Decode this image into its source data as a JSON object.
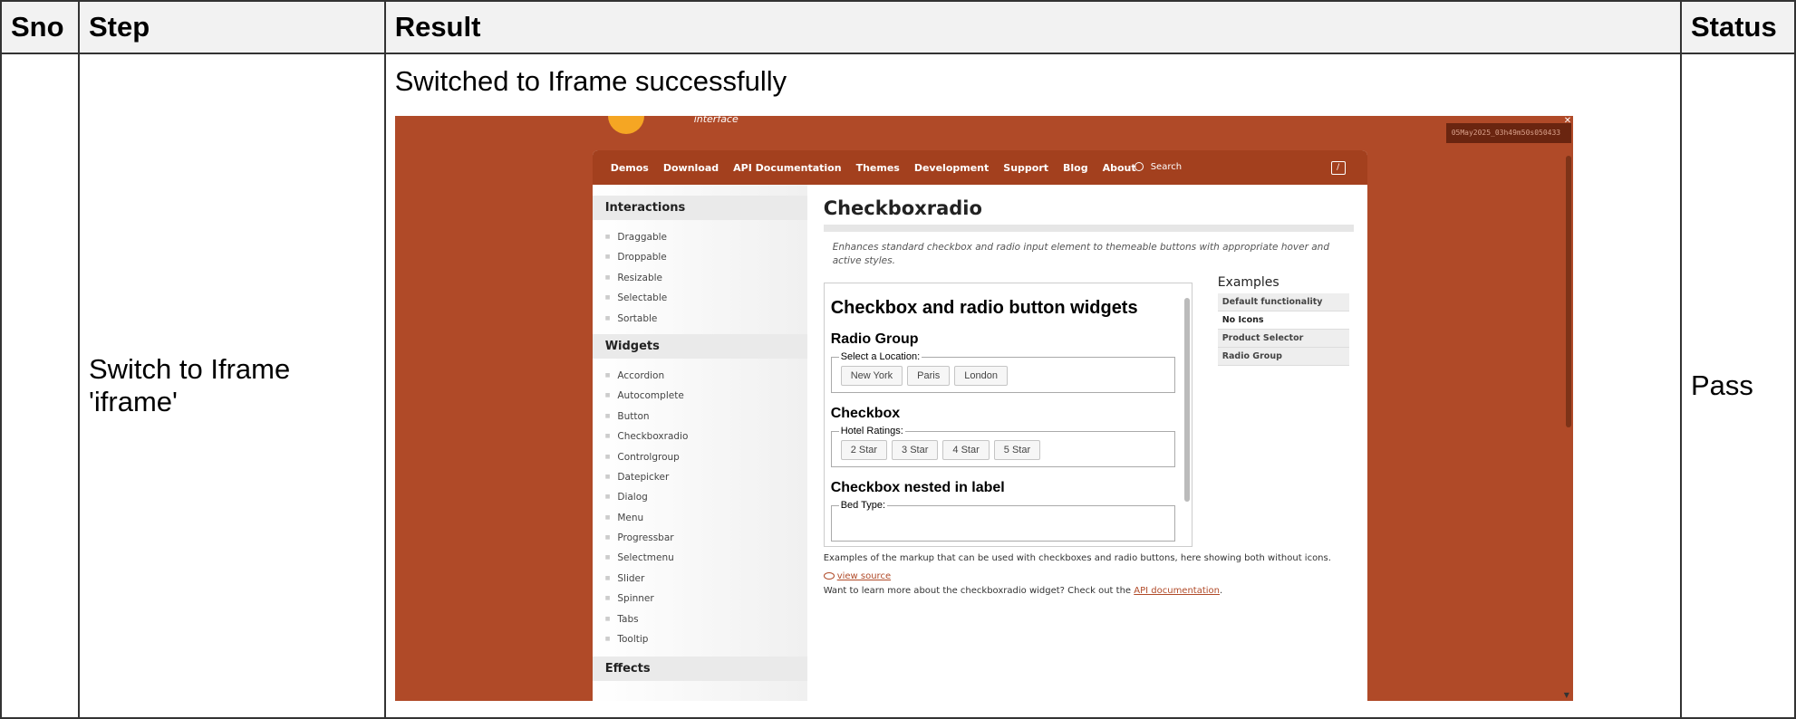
{
  "table": {
    "headers": {
      "sno": "Sno",
      "step": "Step",
      "result": "Result",
      "status": "Status"
    },
    "row": {
      "step": "Switch to Iframe 'iframe'",
      "result_caption": "Switched to Iframe successfully",
      "status": "Pass"
    }
  },
  "screenshot": {
    "logo_sub": "user interface",
    "stamp": "05May2025_03h49m50s050433",
    "nav": [
      "Demos",
      "Download",
      "API Documentation",
      "Themes",
      "Development",
      "Support",
      "Blog",
      "About"
    ],
    "search_placeholder": "Search",
    "slash": "/",
    "sidebar": {
      "interactions_title": "Interactions",
      "interactions": [
        "Draggable",
        "Droppable",
        "Resizable",
        "Selectable",
        "Sortable"
      ],
      "widgets_title": "Widgets",
      "widgets": [
        "Accordion",
        "Autocomplete",
        "Button",
        "Checkboxradio",
        "Controlgroup",
        "Datepicker",
        "Dialog",
        "Menu",
        "Progressbar",
        "Selectmenu",
        "Slider",
        "Spinner",
        "Tabs",
        "Tooltip"
      ],
      "effects_title": "Effects"
    },
    "page_title": "Checkboxradio",
    "description": "Enhances standard checkbox and radio input element to themeable buttons with appropriate hover and active styles.",
    "demo": {
      "title": "Checkbox and radio button widgets",
      "radio_group_title": "Radio Group",
      "location_legend": "Select a Location:",
      "locations": [
        "New York",
        "Paris",
        "London"
      ],
      "checkbox_title": "Checkbox",
      "ratings_legend": "Hotel Ratings:",
      "ratings": [
        "2 Star",
        "3 Star",
        "4 Star",
        "5 Star"
      ],
      "nested_title": "Checkbox nested in label",
      "bed_legend": "Bed Type:"
    },
    "examples": {
      "title": "Examples",
      "items": [
        "Default functionality",
        "No Icons",
        "Product Selector",
        "Radio Group"
      ]
    },
    "footer_text": "Examples of the markup that can be used with checkboxes and radio buttons, here showing both without icons.",
    "view_source": "view source",
    "learn_more": "Want to learn more about the checkboxradio widget? Check out the",
    "api_link": "API documentation",
    "period": "."
  }
}
